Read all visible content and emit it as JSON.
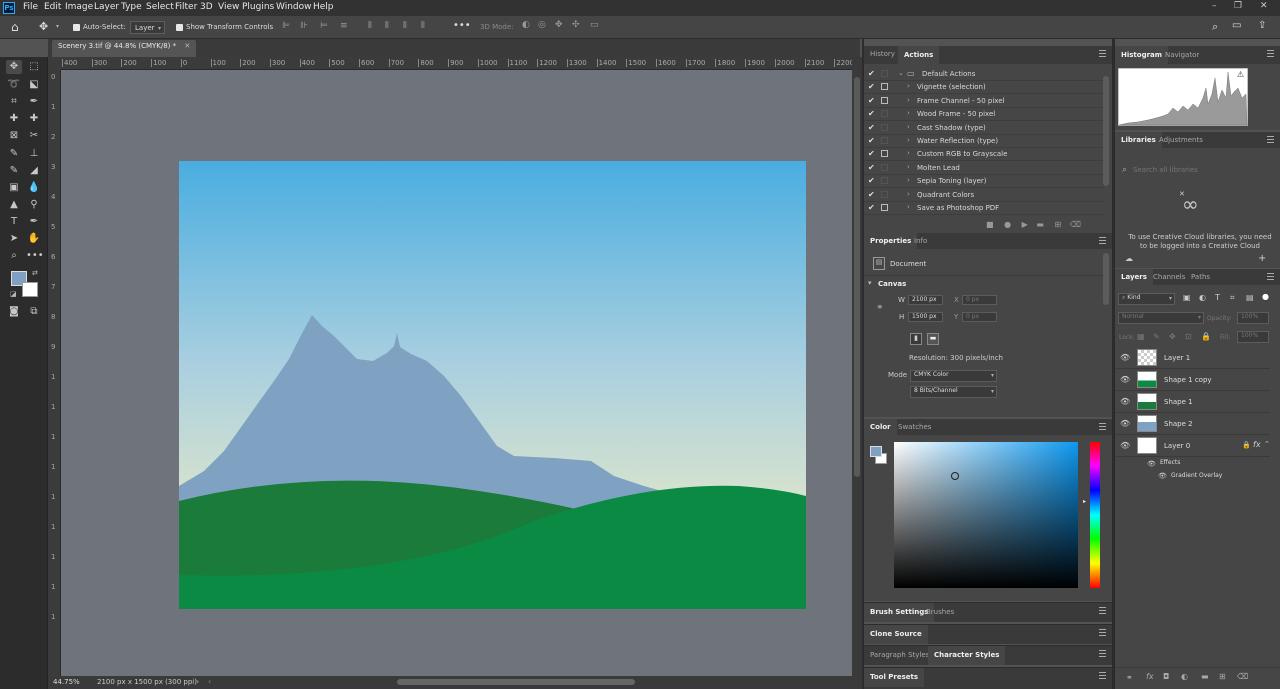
{
  "menubar": {
    "app_icon": "Ps",
    "items": [
      "File",
      "Edit",
      "Image",
      "Layer",
      "Type",
      "Select",
      "Filter",
      "3D",
      "View",
      "Plugins",
      "Window",
      "Help"
    ]
  },
  "options": {
    "auto_select_label": "Auto-Select:",
    "auto_select_value": "Layer",
    "transform_label": "Show Transform Controls",
    "mode_3d_label": "3D Mode:"
  },
  "document": {
    "tab_title": "Scenery 3.tif @ 44.8% (CMYK/8) *",
    "zoom": "44.75%",
    "info": "2100 px x 1500 px (300 ppi)"
  },
  "rulers": {
    "top": [
      "400",
      "300",
      "200",
      "100",
      "0",
      "100",
      "200",
      "300",
      "400",
      "500",
      "600",
      "700",
      "800",
      "900",
      "1000",
      "1100",
      "1200",
      "1300",
      "1400",
      "1500",
      "1600",
      "1700",
      "1800",
      "1900",
      "2000",
      "2100",
      "2200"
    ],
    "left": [
      "0",
      "1",
      "2",
      "3",
      "4",
      "5",
      "6",
      "7",
      "8",
      "9",
      "1",
      "1",
      "1",
      "1",
      "1",
      "1",
      "1",
      "1",
      "1"
    ]
  },
  "history_actions": {
    "tabs": [
      "History",
      "Actions"
    ],
    "set_name": "Default Actions",
    "actions": [
      "Vignette (selection)",
      "Frame Channel - 50 pixel",
      "Wood Frame - 50 pixel",
      "Cast Shadow (type)",
      "Water Reflection (type)",
      "Custom RGB to Grayscale",
      "Molten Lead",
      "Sepia Toning (layer)",
      "Quadrant Colors",
      "Save as Photoshop PDF"
    ],
    "dialog_flags": [
      false,
      true,
      true,
      false,
      false,
      false,
      true,
      false,
      false,
      false,
      true
    ]
  },
  "properties": {
    "tabs": [
      "Properties",
      "Info"
    ],
    "doc_label": "Document",
    "section": "Canvas",
    "w_label": "W",
    "w_value": "2100 px",
    "h_label": "H",
    "h_value": "1500 px",
    "x_label": "X",
    "x_value": "0 px",
    "y_label": "Y",
    "y_value": "0 px",
    "resolution": "Resolution: 300 pixels/inch",
    "mode_label": "Mode",
    "mode_value": "CMYK Color",
    "depth_value": "8 Bits/Channel"
  },
  "color": {
    "tabs": [
      "Color",
      "Swatches"
    ],
    "foreground": "#7fa0c0",
    "background": "#ffffff"
  },
  "collapsed": {
    "brush": [
      "Brush Settings",
      "Brushes"
    ],
    "clone": "Clone Source",
    "styles": [
      "Paragraph Styles",
      "Character Styles"
    ],
    "tool_presets": "Tool Presets"
  },
  "histogram": {
    "tabs": [
      "Histogram",
      "Navigator"
    ]
  },
  "libraries": {
    "tabs": [
      "Libraries",
      "Adjustments"
    ],
    "search_placeholder": "Search all libraries",
    "message": "To use Creative Cloud libraries, you need to be logged into a Creative Cloud"
  },
  "layers": {
    "tabs": [
      "Layers",
      "Channels",
      "Paths"
    ],
    "filter": "Kind",
    "blend": "Normal",
    "opacity_label": "Opacity:",
    "opacity": "100%",
    "lock_label": "Lock:",
    "fill_label": "Fill:",
    "fill": "100%",
    "items": [
      "Layer 1",
      "Shape 1 copy",
      "Shape 1",
      "Shape 2",
      "Layer 0"
    ],
    "effects_label": "Effects",
    "effect_name": "Gradient Overlay"
  }
}
